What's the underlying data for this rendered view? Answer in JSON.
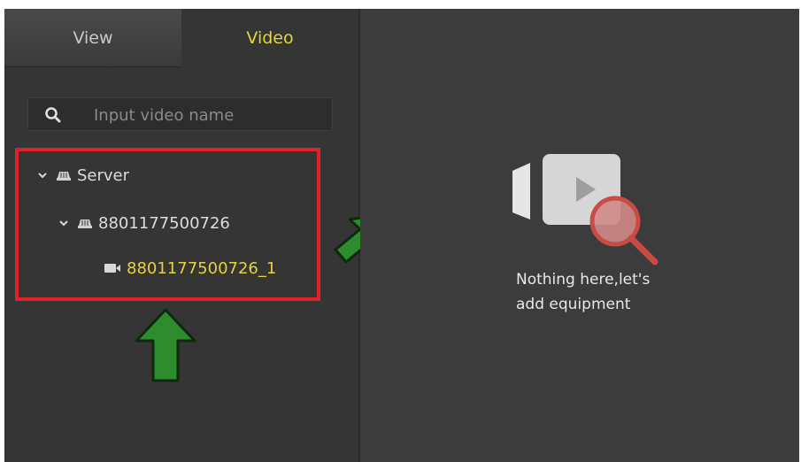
{
  "tabs": [
    {
      "label": "View",
      "active": false
    },
    {
      "label": "Video",
      "active": true
    }
  ],
  "search": {
    "placeholder": "Input video name",
    "icon": "search-icon"
  },
  "tree": {
    "server": {
      "label": "Server",
      "icon": "server-icon",
      "expanded": true
    },
    "device": {
      "label": "8801177500726",
      "icon": "device-icon",
      "expanded": true
    },
    "channel": {
      "label": "8801177500726_1",
      "icon": "camera-icon",
      "selected": true
    }
  },
  "empty_state": {
    "line1": "Nothing here,let's",
    "line2": "add equipment",
    "icon": "video-search-icon"
  },
  "colors": {
    "accent": "#e3d43a",
    "highlight_box": "#e0232a",
    "arrow": "#2e8b2e",
    "panel_bg": "#353535",
    "right_bg": "#3c3c3c"
  }
}
